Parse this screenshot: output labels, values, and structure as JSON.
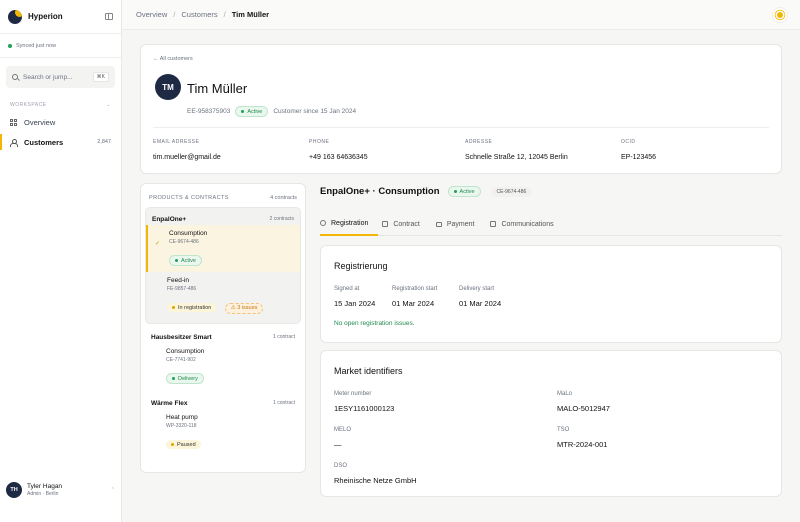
{
  "app": {
    "name": "Hyperion",
    "sync_status": "Synced just now"
  },
  "search": {
    "placeholder": "Search or jump...",
    "shortcut": "⌘K"
  },
  "sidebar": {
    "section": "WORKSPACE",
    "items": [
      {
        "label": "Overview",
        "count": "",
        "icon": "grid-icon"
      },
      {
        "label": "Customers",
        "count": "2,847",
        "icon": "user-icon",
        "active": true
      }
    ],
    "user": {
      "initials": "TH",
      "name": "Tyler Hagan",
      "role": "Admin · Berlin"
    }
  },
  "breadcrumb": [
    "Overview",
    "Customers",
    "Tim Müller"
  ],
  "customer": {
    "back": "← All customers",
    "initials": "TM",
    "name": "Tim Müller",
    "id": "EE-958375903",
    "status": "Active",
    "since": "Customer since 15 Jan 2024",
    "fields": [
      {
        "label": "EMAIL ADRESSE",
        "value": "tim.mueller@gmail.de"
      },
      {
        "label": "PHONE",
        "value": "+49 163 64636345"
      },
      {
        "label": "ADRESSE",
        "value": "Schnelle Straße 12, 12045 Berlin"
      },
      {
        "label": "OCID",
        "value": "EP-123456"
      }
    ]
  },
  "products": {
    "title": "PRODUCTS & CONTRACTS",
    "count": "4 contracts",
    "groups": [
      {
        "name": "EnpalOne+",
        "count": "2 contracts",
        "contracts": [
          {
            "title": "Consumption",
            "id": "CE-9674-486",
            "status": "Active"
          },
          {
            "title": "Feed-in",
            "id": "FE-9857-486",
            "status": "In registration",
            "issues": "⚠ 3 issues"
          }
        ]
      },
      {
        "name": "Hausbesitzer Smart",
        "count": "1 contract",
        "contracts": [
          {
            "title": "Consumption",
            "id": "CE-7741-902",
            "status": "Delivery"
          }
        ]
      },
      {
        "name": "Wärme Flex",
        "count": "1 contract",
        "contracts": [
          {
            "title": "Heat pump",
            "id": "WP-3320-118",
            "status": "Paused"
          }
        ]
      }
    ]
  },
  "detail": {
    "title": "EnpalOne+ · Consumption",
    "status": "Active",
    "id": "CE-9674-486",
    "tabs": [
      "Registration",
      "Contract",
      "Payment",
      "Communications"
    ],
    "registration": {
      "title": "Registrierung",
      "signed_label": "Signed at",
      "signed": "15 Jan 2024",
      "start_label": "Registration start",
      "start": "01 Mar 2024",
      "delivery_label": "Delivery start",
      "delivery": "01 Mar 2024",
      "note": "No open registration issues."
    },
    "market": {
      "title": "Market identifiers",
      "meter_label": "Meter number",
      "meter": "1ESY1161000123",
      "malo_label": "MaLo",
      "malo": "MALO-5012947",
      "melo_label": "MELO",
      "melo": "—",
      "tso_label": "TSO",
      "tso": "MTR-2024-001",
      "dso_label": "DSO",
      "dso": "Rheinische Netze GmbH"
    }
  },
  "colors": {
    "accent": "#f2b705",
    "navy": "#1e2a44",
    "green": "#22a05b"
  }
}
